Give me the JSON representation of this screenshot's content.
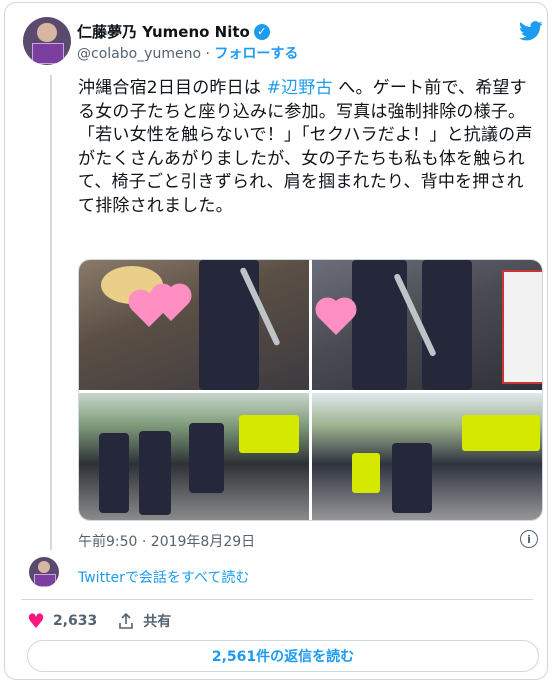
{
  "author": {
    "display_name": "仁藤夢乃 Yumeno Nito",
    "handle": "@colabo_yumeno",
    "separator": "·",
    "follow_label": "フォローする",
    "verified_icon": "verified-badge-icon"
  },
  "tweet": {
    "text_before_hashtag": "沖縄合宿2日目の昨日は ",
    "hashtag": "#辺野古",
    "text_after_hashtag": " へ。ゲート前で、希望する女の子たちと座り込みに参加。写真は強制排除の様子。「若い女性を触らないで！」「セクハラだよ！」と抗議の声がたくさんあがりましたが、女の子たちも私も体を触られて、椅子ごと引きずられ、肩を掴まれたり、背中を押されて排除されました。",
    "timestamp": "午前9:50 · 2019年8月29日"
  },
  "photos": [
    {
      "name": "photo-sit-in-1"
    },
    {
      "name": "photo-sit-in-2"
    },
    {
      "name": "photo-police-line-1"
    },
    {
      "name": "photo-police-line-2"
    }
  ],
  "conversation_link": "Twitterで会話をすべて読む",
  "actions": {
    "like_count": "2,633",
    "share_label": "共有"
  },
  "replies_button": "2,561件の返信を読む",
  "colors": {
    "accent": "#1d9bf0",
    "like": "#f91880",
    "muted": "#536471",
    "border": "#cfd9de"
  }
}
